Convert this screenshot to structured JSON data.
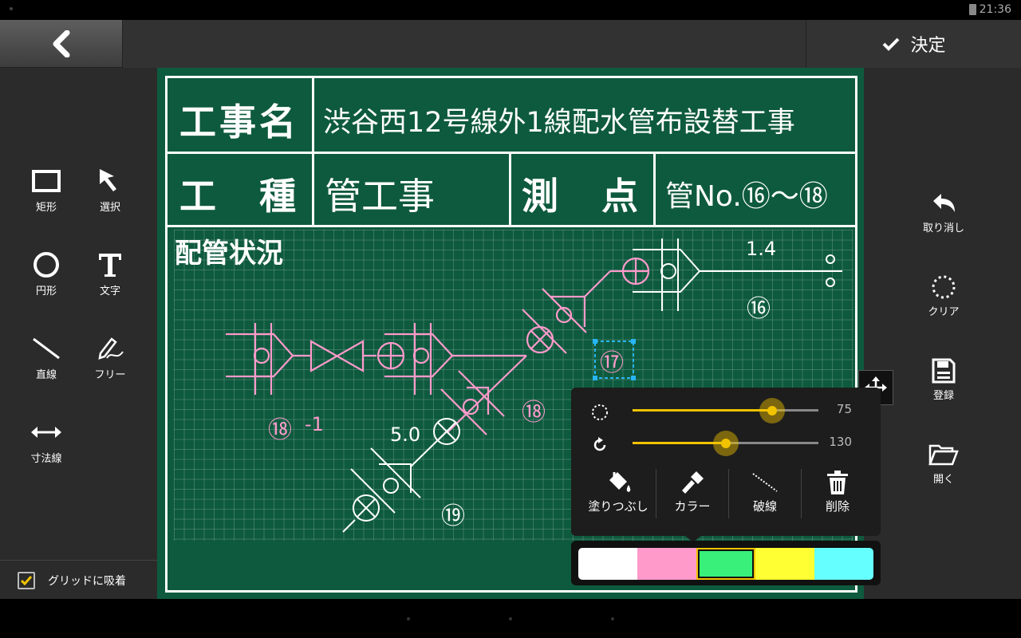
{
  "status": {
    "time": "21:36"
  },
  "topbar": {
    "confirm_label": "決定"
  },
  "left_tools": [
    {
      "label": "矩形",
      "icon": "rectangle-icon"
    },
    {
      "label": "選択",
      "icon": "cursor-arrow-icon"
    },
    {
      "label": "円形",
      "icon": "circle-icon"
    },
    {
      "label": "文字",
      "icon": "text-icon"
    },
    {
      "label": "直線",
      "icon": "line-icon"
    },
    {
      "label": "フリー",
      "icon": "freehand-pen-icon"
    },
    {
      "label": "寸法線",
      "icon": "dimension-arrow-icon"
    }
  ],
  "grid_snap": {
    "label": "グリッドに吸着",
    "checked": true
  },
  "right_tools": [
    {
      "label": "取り消し",
      "icon": "undo-icon"
    },
    {
      "label": "クリア",
      "icon": "clear-dotted-circle-icon"
    },
    {
      "label": "登録",
      "icon": "save-icon"
    },
    {
      "label": "開く",
      "icon": "folder-open-icon"
    }
  ],
  "board": {
    "row1_label": "工事名",
    "row1_value": "渋谷西12号線外1線配水管布設替工事",
    "row2_label": "工　種",
    "row2_value": "管工事",
    "row2_label2": "測　点",
    "row2_value2": "管No.⑯～⑱",
    "section_title": "配管状況",
    "drawing_labels": {
      "a": "1.4",
      "b": "⑯",
      "c": "⑰",
      "d": "⑱",
      "e": "⑱",
      "f": "-1",
      "g": "5.0",
      "h": "⑲"
    }
  },
  "popup": {
    "opacity_value": "75",
    "rotation_value": "130",
    "opacity_level": 0.75,
    "rotation_level": 0.5,
    "actions": [
      {
        "label": "塗りつぶし",
        "icon": "fill-bucket-icon"
      },
      {
        "label": "カラー",
        "icon": "color-brush-icon"
      },
      {
        "label": "破線",
        "icon": "dashed-line-icon"
      },
      {
        "label": "削除",
        "icon": "trash-icon"
      }
    ]
  },
  "palette": {
    "colors": [
      "#ffffff",
      "#ff9acb",
      "#38f07a",
      "#ffff33",
      "#66ffff"
    ],
    "selected": 2
  }
}
